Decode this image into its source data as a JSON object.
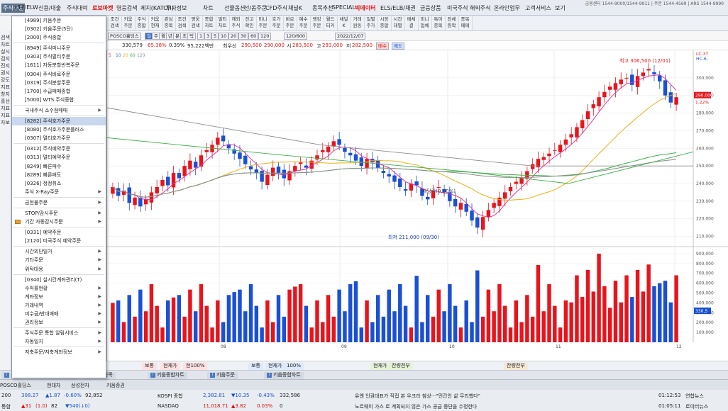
{
  "menubar": {
    "items": [
      "주식주문",
      "ETF/ELW",
      "신용/대출",
      "주식대여",
      "로보마켓",
      "영웅검색",
      "제치(KATCH)",
      "투자정보",
      "차트",
      "선물옵션",
      "선/옵주문",
      "CFD주식",
      "채널K",
      "종목추천",
      "SPECIAL",
      "빅데이터",
      "ELS/ELB/채권",
      "금융상품",
      "미국주식",
      "해외주식",
      "온라인업무",
      "고객서비스",
      "보기"
    ],
    "topright": "금융센터 1544-9000/1544-9911 | 주문 1544-4569 | ARS 1544-9990"
  },
  "toolbar": {
    "buttons": [
      "조건\n검색",
      "키움\n주문",
      "주식\n종합",
      "키움\n현재",
      "관심\n종목",
      "조건\n검색",
      "영웅\n검색",
      "종합\n차트",
      "멀티\n차트",
      "해외\n주식",
      "잔고\n확인",
      "미니\n주문",
      "호가\n주문",
      "바로\n주문",
      "예수\n주문",
      "랭킹\n주문",
      "월드\n티커",
      "채널\nK",
      "거래\n원동",
      "일별\n주가",
      "시장\n종합",
      "시간\n대별",
      "메체\n결",
      "미니\n업체",
      "특이\n종목",
      "전체\n등락",
      "종목\n메매"
    ],
    "date": "2022/12/07",
    "count": "120/600"
  },
  "ticker": {
    "name": "POSCO홀딩스",
    "volume": "330,579",
    "rate": "65.38%",
    "rate2": "0.39%",
    "amount": "95,222백만",
    "prev_label": "최우선",
    "p1": "290,500",
    "p2": "290,000",
    "open_label": "시",
    "open": "283,500",
    "high_label": "고",
    "high": "293,000",
    "low_label": "저",
    "low": "282,500",
    "buy": "매수",
    "sell": "매도"
  },
  "ma_legend": [
    "5",
    "10",
    "20",
    "60",
    "120"
  ],
  "chart_data": {
    "type": "candlestick",
    "price_axis": [
      300000,
      290000,
      280000,
      270000,
      260000,
      250000,
      240000,
      230000,
      220000,
      210000
    ],
    "volume_axis": [
      "900,000",
      "800,000",
      "700,000",
      "600,000",
      "500,000",
      "400,000",
      "300,000",
      "200,000",
      "100,000"
    ],
    "x_labels": [
      "08",
      "09",
      "10",
      "11",
      "12"
    ],
    "annotations": {
      "high": "최고 306,500 (12/01)",
      "low": "최저 211,000 (09/30)",
      "dividend": "배당락(0.00%)"
    },
    "current_price_tag": "290,000",
    "current_rate_tag": "1.22%",
    "right_top_tags": [
      "LC-37",
      "HC-6,"
    ],
    "volume_tag": "330,5",
    "closes": [
      238,
      233,
      236,
      229,
      232,
      227,
      231,
      235,
      238,
      242,
      239,
      246,
      243,
      250,
      253,
      249,
      256,
      259,
      262,
      266,
      264,
      260,
      257,
      254,
      251,
      248,
      246,
      241,
      245,
      249,
      246,
      243,
      247,
      250,
      252,
      249,
      253,
      256,
      259,
      261,
      264,
      262,
      258,
      256,
      253,
      250,
      254,
      252,
      249,
      246,
      244,
      241,
      238,
      236,
      240,
      239,
      233,
      231,
      236,
      238,
      235,
      230,
      227,
      229,
      224,
      219,
      215,
      221,
      225,
      229,
      232,
      235,
      238,
      241,
      243,
      247,
      251,
      254,
      255,
      257,
      259,
      262,
      265,
      268,
      272,
      276,
      281,
      285,
      289,
      292,
      295,
      297,
      299,
      300,
      296,
      301,
      303,
      305,
      302,
      298,
      290,
      286,
      289
    ]
  },
  "dropdown": {
    "items": [
      {
        "label": "[4989] 키움주문",
        "arrow": false
      },
      {
        "label": "[0302] 키움주문(5단)",
        "arrow": false
      },
      {
        "label": "[2000] 주식종합",
        "arrow": false
      },
      {
        "sep": true
      },
      {
        "label": "[8949] 주식미니주문",
        "arrow": false
      },
      {
        "label": "[0303] 주식멀티주문",
        "arrow": false
      },
      {
        "label": "[1611] 자동분할반복주문",
        "arrow": false
      },
      {
        "label": "[0304] 주식바로주문",
        "arrow": false
      },
      {
        "label": "[0319] 주식분할주문",
        "arrow": false
      },
      {
        "label": "[1700] 수급매매종합",
        "arrow": false
      },
      {
        "label": "[5000] WTS 주식종합",
        "arrow": false
      },
      {
        "sep": true
      },
      {
        "label": "국내주식 소수점매매",
        "arrow": true
      },
      {
        "sep": true
      },
      {
        "label": "[8282] 주식호가주문",
        "arrow": false,
        "selected": true
      },
      {
        "label": "[8080] 주식호가주문플러스",
        "arrow": false
      },
      {
        "label": "[0307] 멀티호가주문",
        "arrow": false
      },
      {
        "sep": true
      },
      {
        "label": "[0312] 주식예약주문",
        "arrow": false
      },
      {
        "label": "[0313] 멀티예약주문",
        "arrow": false
      },
      {
        "label": "[8249] 빠른매수",
        "arrow": false
      },
      {
        "label": "[8289] 빠른매도",
        "arrow": false
      },
      {
        "label": "[0326] 정정취소",
        "arrow": false
      },
      {
        "label": "주식 X-Ray주문",
        "arrow": true
      },
      {
        "sep": true
      },
      {
        "label": "금현물주문",
        "arrow": true
      },
      {
        "sep": true
      },
      {
        "label": "STOP/감시주문",
        "arrow": true
      },
      {
        "label": "기간 자동감시주문",
        "arrow": true,
        "icon": true
      },
      {
        "sep": true
      },
      {
        "label": "[0331] 예약주문",
        "arrow": false
      },
      {
        "label": "[2120] 미국주식 예약주문",
        "arrow": false
      },
      {
        "sep": true
      },
      {
        "label": "시간외단일가",
        "arrow": true
      },
      {
        "label": "기타주문",
        "arrow": true
      },
      {
        "label": "위탁대용",
        "arrow": true
      },
      {
        "sep": true
      },
      {
        "label": "[0340] 실시간계좌관리(T)",
        "arrow": false
      },
      {
        "label": "수익률현황",
        "arrow": true
      },
      {
        "label": "계좌정보",
        "arrow": true
      },
      {
        "label": "거래내역",
        "arrow": true
      },
      {
        "label": "미수금/반대매매",
        "arrow": true
      },
      {
        "label": "권리정보",
        "arrow": true
      },
      {
        "sep": true
      },
      {
        "label": "주식주문 통합 알림서비스",
        "arrow": true
      },
      {
        "label": "자동일지",
        "arrow": true
      },
      {
        "sep": true
      },
      {
        "label": "저축주문/저축계좌정보",
        "arrow": true
      }
    ]
  },
  "leftstrip": [
    "검색",
    "차트",
    "실시",
    "검지",
    "진지",
    "권시",
    "강도",
    "지표",
    "창지",
    "홀선",
    "지표",
    "지표",
    "자보"
  ],
  "bottombar1": {
    "labels": [
      "보통",
      "현재가",
      "현100%",
      "보통",
      "현재가",
      "100%",
      "현재가",
      "잔량전부",
      "잔량전부"
    ]
  },
  "bottombar2": {
    "tabs": [
      "신대매동학",
      "투자자별매매동",
      "관심종목",
      "키움종합차트",
      "키움주문",
      "키움종합차트"
    ]
  },
  "ticker_rows": [
    {
      "c1": "200",
      "c2": "308.27",
      "c3": "▲1.87",
      "c4": "-0.60%",
      "c5": "92,852",
      "c6": "KOSPI 종합",
      "c7": "2,382.81",
      "c8": "▼10.35",
      "c9": "-0.43%",
      "c10": "332,586",
      "news": "유엔 인권대표가 직접 본 우크라 참상···\"민간인 삶 무리했다\"",
      "time": "01:12:53",
      "src": "연합뉴스"
    },
    {
      "c1": "통합",
      "c2": "▲31",
      "c3": "(1.0)",
      "c4": "82",
      "c5": "▼540(↓0)",
      "c6": "NASDAQ",
      "c7": "11,018.71",
      "c8": "▲3.82",
      "c9": "0.03%",
      "c10": "0",
      "news": "노르웨이 가스 로 계획되지 않은 가스 공급 중단을 수정한다",
      "time": "01:05:11",
      "src": "로이터뉴스"
    }
  ],
  "bottom_tabs": [
    "POSCO홀딩스",
    "현대차",
    "삼성전자",
    "키움증권"
  ],
  "colors": {
    "up": "#e8141c",
    "down": "#1a50d4",
    "ma5": "#e0379b",
    "ma20": "#e8b115",
    "ma60": "#3fb04a",
    "ma120": "#8c8c8c"
  }
}
